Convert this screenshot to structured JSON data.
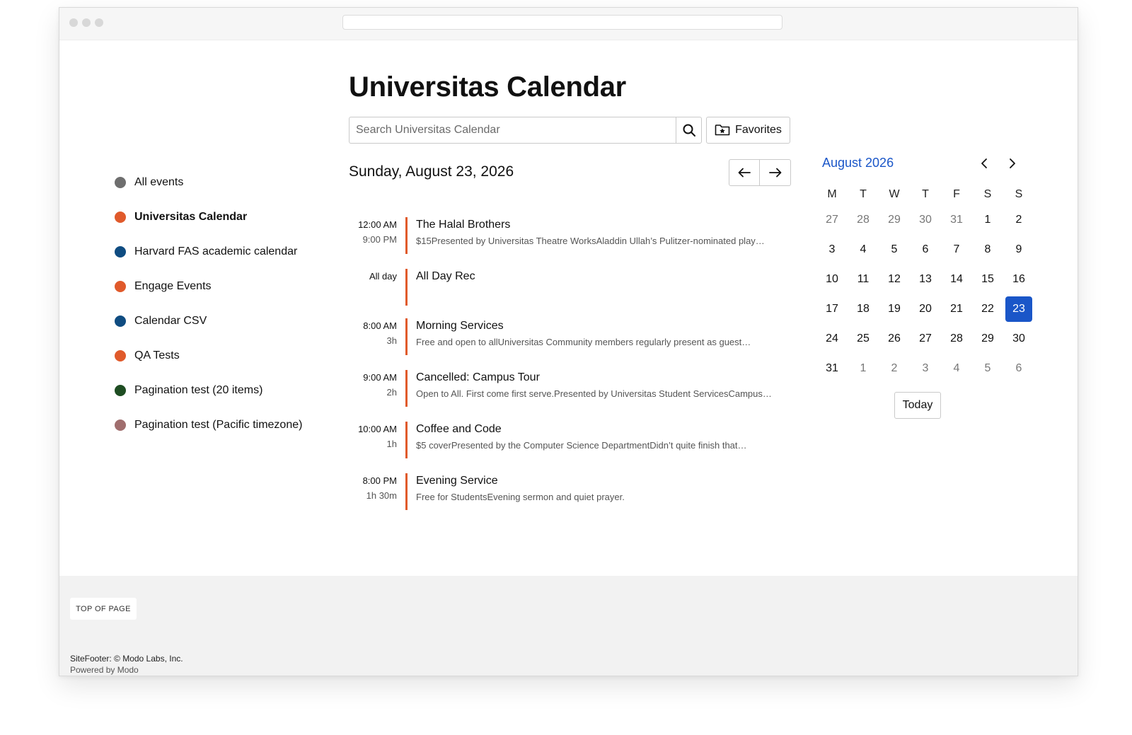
{
  "header": {
    "title": "Universitas Calendar",
    "search_placeholder": "Search Universitas Calendar",
    "favorites_label": "Favorites"
  },
  "sidebar": {
    "items": [
      {
        "label": "All events",
        "color": "#6e6e6e",
        "active": false
      },
      {
        "label": "Universitas Calendar",
        "color": "#e05a2b",
        "active": true
      },
      {
        "label": "Harvard FAS academic calendar",
        "color": "#0f4c81",
        "active": false
      },
      {
        "label": "Engage Events",
        "color": "#e05a2b",
        "active": false
      },
      {
        "label": "Calendar CSV",
        "color": "#0f4c81",
        "active": false
      },
      {
        "label": "QA Tests",
        "color": "#e05a2b",
        "active": false
      },
      {
        "label": "Pagination test (20 items)",
        "color": "#1e4d22",
        "active": false
      },
      {
        "label": "Pagination test (Pacific timezone)",
        "color": "#a06e6e",
        "active": false
      }
    ]
  },
  "day_view": {
    "date": "Sunday, August 23, 2026",
    "events": [
      {
        "start": "12:00 AM",
        "end": "9:00 PM",
        "title": "The Halal Brothers",
        "desc": "$15Presented by Universitas Theatre WorksAladdin Ullah’s Pulitzer-nominated play…"
      },
      {
        "start": "All day",
        "end": "",
        "title": "All Day Rec",
        "desc": ""
      },
      {
        "start": "8:00 AM",
        "end": "3h",
        "title": "Morning Services",
        "desc": "Free and open to allUniversitas Community members regularly present as guest…"
      },
      {
        "start": "9:00 AM",
        "end": "2h",
        "title": "Cancelled: Campus Tour",
        "desc": "Open to All. First come first serve.Presented by Universitas Student ServicesCampus…"
      },
      {
        "start": "10:00 AM",
        "end": "1h",
        "title": "Coffee and Code",
        "desc": "$5 coverPresented by the Computer Science DepartmentDidn’t quite finish that…"
      },
      {
        "start": "8:00 PM",
        "end": "1h 30m",
        "title": "Evening Service",
        "desc": "Free for StudentsEvening sermon and quiet prayer."
      }
    ]
  },
  "mini_calendar": {
    "month": "August 2026",
    "weekdays": [
      "M",
      "T",
      "W",
      "T",
      "F",
      "S",
      "S"
    ],
    "weeks": [
      [
        "27",
        "28",
        "29",
        "30",
        "31",
        "1",
        "2"
      ],
      [
        "3",
        "4",
        "5",
        "6",
        "7",
        "8",
        "9"
      ],
      [
        "10",
        "11",
        "12",
        "13",
        "14",
        "15",
        "16"
      ],
      [
        "17",
        "18",
        "19",
        "20",
        "21",
        "22",
        "23"
      ],
      [
        "24",
        "25",
        "26",
        "27",
        "28",
        "29",
        "30"
      ],
      [
        "31",
        "1",
        "2",
        "3",
        "4",
        "5",
        "6"
      ]
    ],
    "other_month": [
      [
        true,
        true,
        true,
        true,
        true,
        false,
        false
      ],
      [
        false,
        false,
        false,
        false,
        false,
        false,
        false
      ],
      [
        false,
        false,
        false,
        false,
        false,
        false,
        false
      ],
      [
        false,
        false,
        false,
        false,
        false,
        false,
        false
      ],
      [
        false,
        false,
        false,
        false,
        false,
        false,
        false
      ],
      [
        false,
        true,
        true,
        true,
        true,
        true,
        true
      ]
    ],
    "selected_day": "23",
    "today_label": "Today",
    "accent_color": "#1a56c8"
  },
  "footer": {
    "top_of_page": "TOP OF PAGE",
    "copyright": "SiteFooter: © Modo Labs, Inc.",
    "powered_by": "Powered by Modo"
  }
}
